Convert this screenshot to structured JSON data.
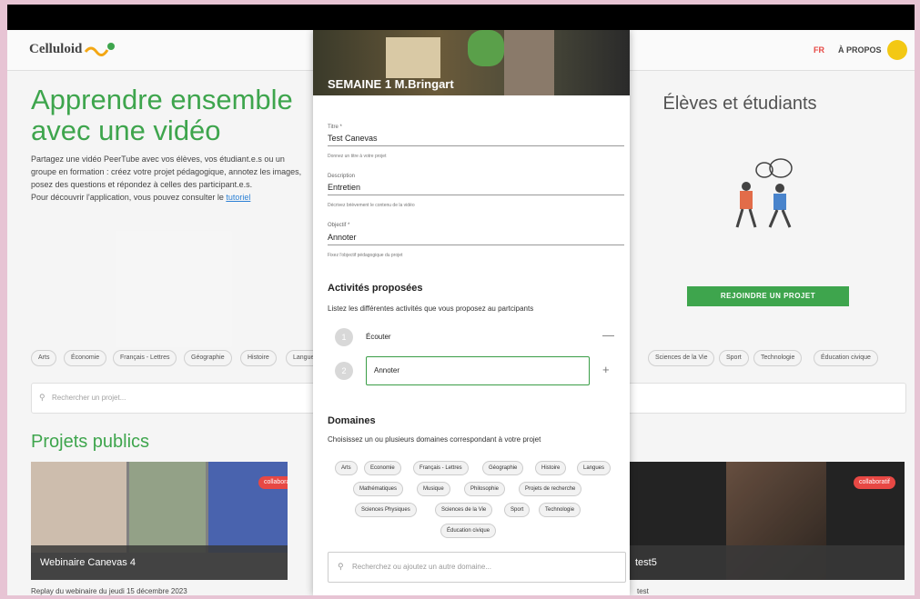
{
  "nav": {
    "logo": "Celluloid",
    "lang": "FR",
    "about": "À PROPOS"
  },
  "hero": {
    "title": "Apprendre ensemble avec une vidéo",
    "text": "Partagez une vidéo PeerTube avec vos élèves, vos étudiant.e.s ou un groupe en formation : créez votre projet pédagogique, annotez les images, posez des questions et répondez à celles des participant.e.s.",
    "tutorial_prefix": "Pour découvrir l'application, vous pouvez consulter le ",
    "tutorial_link": "tutoriel"
  },
  "right_panel": {
    "title": "Élèves et étudiants",
    "join_button": "REJOINDRE UN PROJET"
  },
  "background_chips": [
    "Arts",
    "Économie",
    "Français - Lettres",
    "Géographie",
    "Histoire",
    "Langues",
    "Sciences de la Vie",
    "Sport",
    "Technologie",
    "Éducation civique"
  ],
  "background_search": "Rechercher un projet...",
  "projects": {
    "title": "Projets publics",
    "cards": [
      {
        "title": "Webinaire Canevas 4",
        "badge": "collaboratif",
        "desc": "Replay du webinaire du jeudi 15 décembre 2023"
      },
      {
        "title": "test5",
        "badge": "collaboratif",
        "desc": "test"
      }
    ]
  },
  "modal": {
    "header": "SEMAINE 1 M.Bringart",
    "fields": [
      {
        "label": "Titre *",
        "value": "Test Canevas",
        "hint": "Donnez un titre à votre projet"
      },
      {
        "label": "Description",
        "value": "Entretien",
        "hint": "Décrivez brièvement le contenu de la vidéo"
      },
      {
        "label": "Objectif *",
        "value": "Annoter",
        "hint": "Fixez l'objectif pédagogique du projet"
      }
    ],
    "activities": {
      "title": "Activités proposées",
      "subtitle": "Listez les différentes activités que vous proposez au partcipants",
      "items": [
        {
          "num": "1",
          "text": "Écouter",
          "action": "—"
        },
        {
          "num": "2",
          "text": "Annoter",
          "action": "+"
        }
      ]
    },
    "domains": {
      "title": "Domaines",
      "subtitle": "Choisissez un ou plusieurs domaines correspondant à votre projet",
      "chips": [
        "Arts",
        "Economie",
        "Français - Lettres",
        "Géographie",
        "Histoire",
        "Langues",
        "Mathématiques",
        "Musique",
        "Philosophie",
        "Projets de recherche",
        "Sciences Physiques",
        "Sciences de la Vie",
        "Sport",
        "Technologie",
        "Éducation civique"
      ],
      "search_placeholder": "Recherchez ou ajoutez un autre domaine..."
    }
  },
  "colors": {
    "brand_green": "#2e9e3e",
    "badge_red": "#e53935",
    "avatar_yellow": "#f2c400"
  }
}
